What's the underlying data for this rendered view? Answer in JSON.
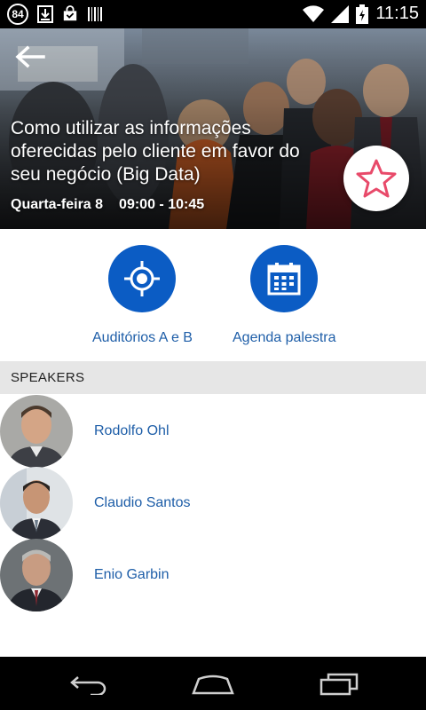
{
  "status_bar": {
    "notification_count": "84",
    "time": "11:15",
    "icons": [
      "download-icon",
      "store-bag-icon",
      "barcode-icon",
      "wifi-icon",
      "signal-icon",
      "battery-icon"
    ]
  },
  "hero": {
    "title": "Como utilizar as informações oferecidas pelo cliente em favor do seu negócio (Big Data)",
    "day": "Quarta-feira 8",
    "time_range": "09:00 - 10:45",
    "favorite_color": "#e84a6a"
  },
  "actions": {
    "location_label": "Auditórios A e B",
    "agenda_label": "Agenda palestra",
    "accent_color": "#0b5cc4"
  },
  "speakers": {
    "header": "SPEAKERS",
    "items": [
      {
        "name": "Rodolfo Ohl"
      },
      {
        "name": "Claudio Santos"
      },
      {
        "name": "Enio Garbin"
      }
    ]
  }
}
